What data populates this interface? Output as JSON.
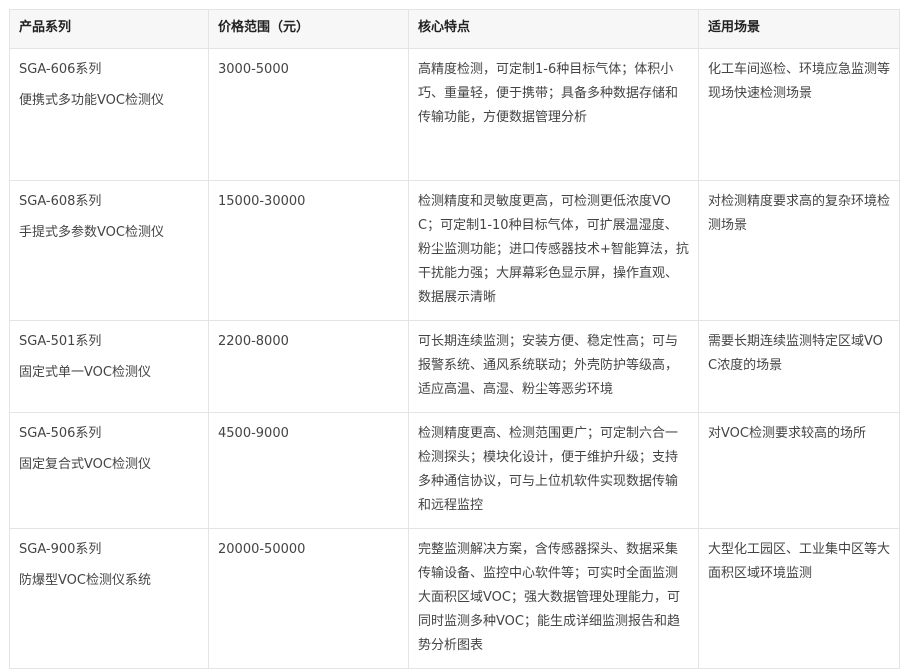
{
  "table": {
    "headers": [
      "产品系列",
      "价格范围（元）",
      "核心特点",
      "适用场景"
    ],
    "rows": [
      {
        "series": "SGA-606系列",
        "name": "便携式多功能VOC检测仪",
        "price": "3000-5000",
        "features": "高精度检测，可定制1-6种目标气体；体积小巧、重量轻，便于携带；具备多种数据存储和传输功能，方便数据管理分析",
        "scenario": "化工车间巡检、环境应急监测等现场快速检测场景"
      },
      {
        "series": "SGA-608系列",
        "name": "手提式多参数VOC检测仪",
        "price": "15000-30000",
        "features": "检测精度和灵敏度更高，可检测更低浓度VOC；可定制1-10种目标气体，可扩展温湿度、粉尘监测功能；进口传感器技术+智能算法，抗干扰能力强；大屏幕彩色显示屏，操作直观、数据展示清晰",
        "scenario": "对检测精度要求高的复杂环境检测场景"
      },
      {
        "series": "SGA-501系列",
        "name": "固定式单一VOC检测仪",
        "price": "2200-8000",
        "features": "可长期连续监测；安装方便、稳定性高；可与报警系统、通风系统联动；外壳防护等级高，适应高温、高湿、粉尘等恶劣环境",
        "scenario": "需要长期连续监测特定区域VOC浓度的场景"
      },
      {
        "series": "SGA-506系列",
        "name": "固定复合式VOC检测仪",
        "price": "4500-9000",
        "features": "检测精度更高、检测范围更广；可定制六合一检测探头；模块化设计，便于维护升级；支持多种通信协议，可与上位机软件实现数据传输和远程监控",
        "scenario": "对VOC检测要求较高的场所"
      },
      {
        "series": "SGA-900系列",
        "name": "防爆型VOC检测仪系统",
        "price": "20000-50000",
        "features": "完整监测解决方案，含传感器探头、数据采集传输设备、监控中心软件等；可实时全面监测大面积区域VOC；强大数据管理处理能力，可同时监测多种VOC；能生成详细监测报告和趋势分析图表",
        "scenario": "大型化工园区、工业集中区等大面积区域环境监测"
      }
    ]
  }
}
